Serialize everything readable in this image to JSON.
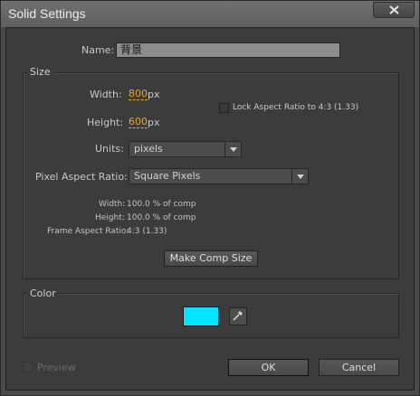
{
  "window": {
    "title": "Solid Settings"
  },
  "name": {
    "label": "Name:",
    "value": "背景"
  },
  "size": {
    "group_label": "Size",
    "width_label": "Width:",
    "width_value": "800",
    "width_unit": "px",
    "height_label": "Height:",
    "height_value": "600",
    "height_unit": "px",
    "lock_aspect_label": "Lock Aspect Ratio to 4:3 (1.33)",
    "units_label": "Units:",
    "units_value": "pixels",
    "pixel_aspect_label": "Pixel Aspect Ratio:",
    "pixel_aspect_value": "Square Pixels",
    "info": {
      "width_label": "Width:",
      "width_value": "100.0 % of comp",
      "height_label": "Height:",
      "height_value": "100.0 % of comp",
      "frame_aspect_label": "Frame Aspect Ratio:",
      "frame_aspect_value": "4:3 (1.33)"
    },
    "make_comp_size_label": "Make Comp Size"
  },
  "color": {
    "group_label": "Color",
    "swatch_hex": "#00e4ff"
  },
  "footer": {
    "preview_label": "Preview",
    "ok_label": "OK",
    "cancel_label": "Cancel"
  },
  "icons": {
    "close": "close-icon",
    "eyedropper": "eyedropper-icon",
    "dropdown": "chevron-down-icon"
  }
}
